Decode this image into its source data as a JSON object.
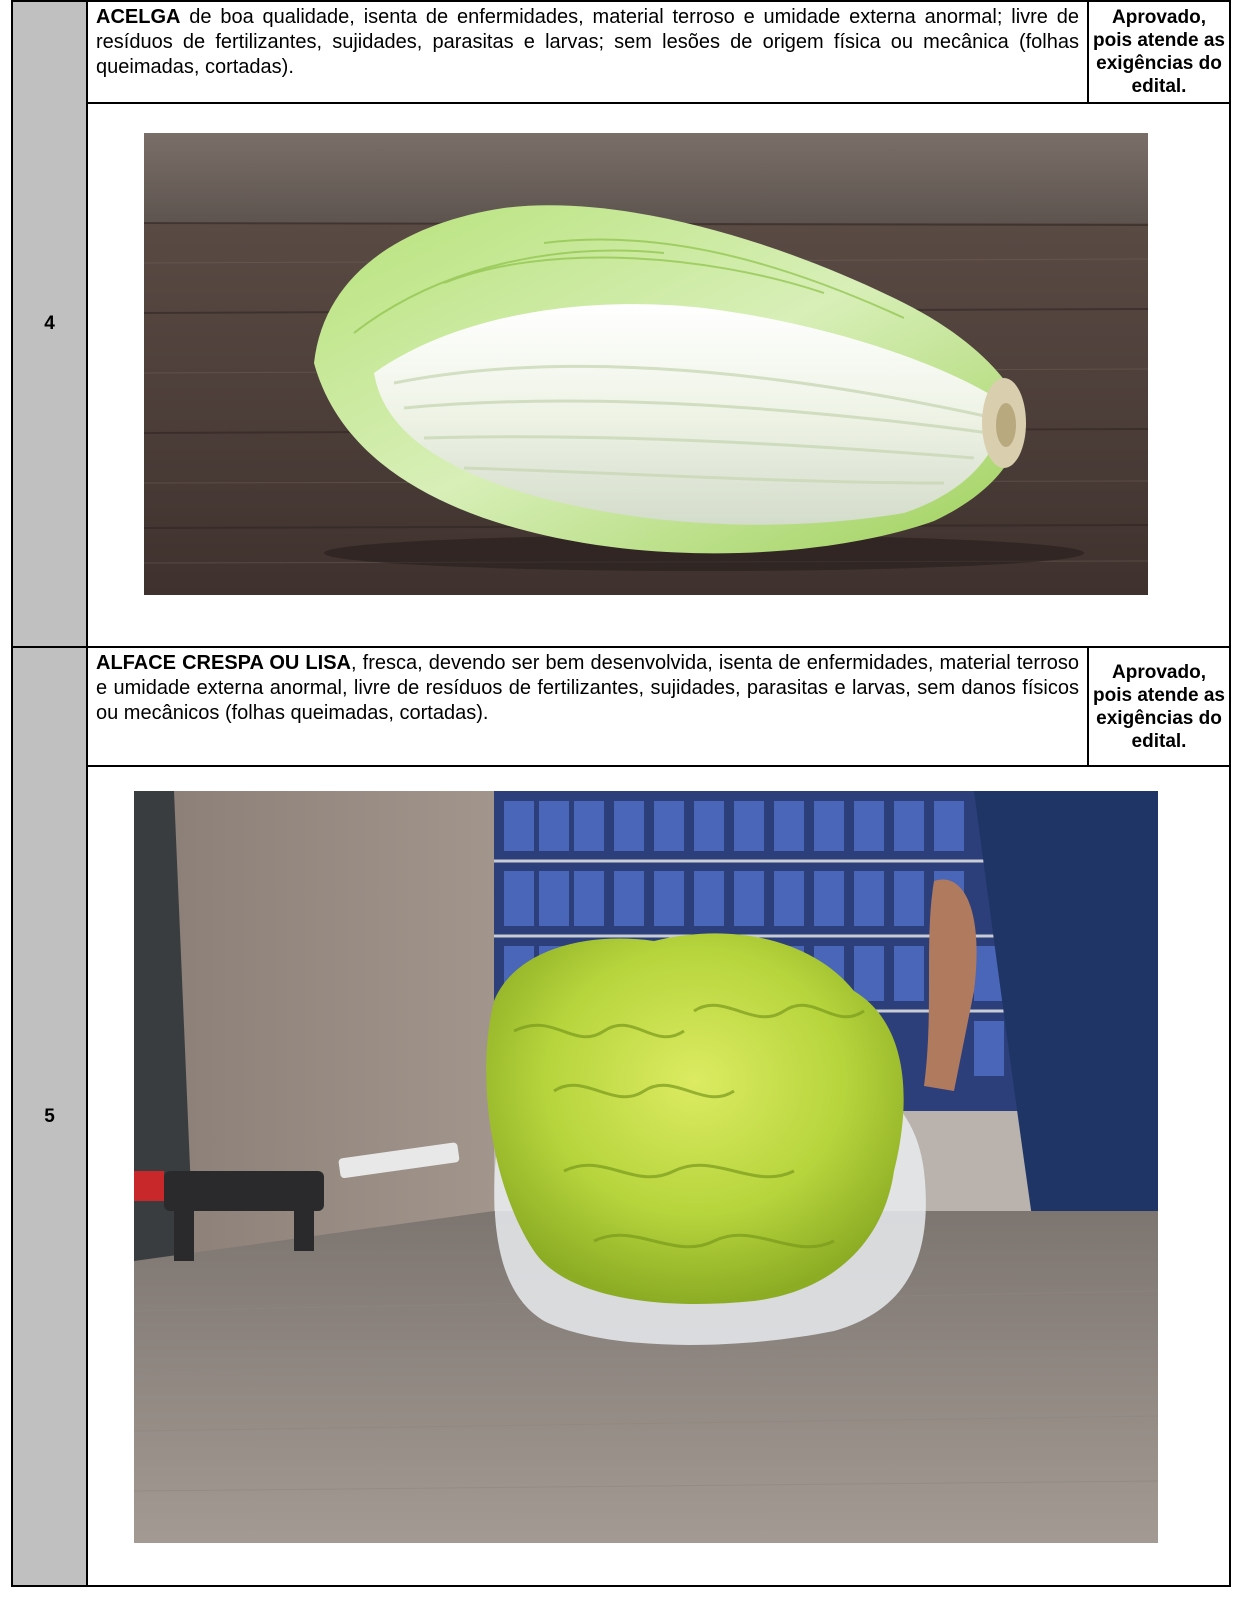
{
  "rows": [
    {
      "number": "4",
      "item_name": "ACELGA",
      "description_rest": " de boa qualidade, isenta de enfermidades, material terroso e umidade externa anormal; livre de resíduos de fertilizantes, sujidades, parasitas e larvas; sem lesões de origem física ou mecânica (folhas queimadas, cortadas).",
      "status": "Aprovado, pois atende as exigências do edital.",
      "photo_subject": "acelga-photo"
    },
    {
      "number": "5",
      "item_name": "ALFACE CRESPA OU LISA",
      "description_rest": ", fresca, devendo ser bem desenvolvida, isenta de enfermidades, material terroso e umidade externa anormal, livre de resíduos de fertilizantes, sujidades, parasitas e larvas, sem danos físicos ou mecânicos (folhas queimadas, cortadas).",
      "status": "Aprovado, pois atende as exigências do edital.",
      "photo_subject": "alface-photo"
    }
  ],
  "colors": {
    "number_column_bg": "#c0c0c0",
    "border": "#000000"
  }
}
